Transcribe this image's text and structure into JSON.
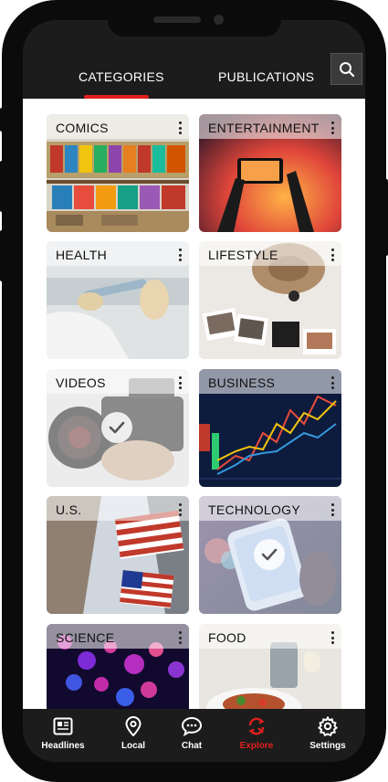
{
  "tabs": {
    "categories_label": "CATEGORIES",
    "publications_label": "PUBLICATIONS"
  },
  "categories": [
    {
      "label": "COMICS",
      "selected": false
    },
    {
      "label": "ENTERTAINMENT",
      "selected": false
    },
    {
      "label": "HEALTH",
      "selected": false
    },
    {
      "label": "LIFESTYLE",
      "selected": false
    },
    {
      "label": "VIDEOS",
      "selected": true
    },
    {
      "label": "BUSINESS",
      "selected": false
    },
    {
      "label": "U.S.",
      "selected": false
    },
    {
      "label": "TECHNOLOGY",
      "selected": true
    },
    {
      "label": "SCIENCE",
      "selected": false
    },
    {
      "label": "FOOD",
      "selected": false
    }
  ],
  "nav": {
    "headlines": "Headlines",
    "local": "Local",
    "chat": "Chat",
    "explore": "Explore",
    "settings": "Settings"
  },
  "colors": {
    "accent": "#e0201e",
    "bar": "#1c1c1c"
  }
}
